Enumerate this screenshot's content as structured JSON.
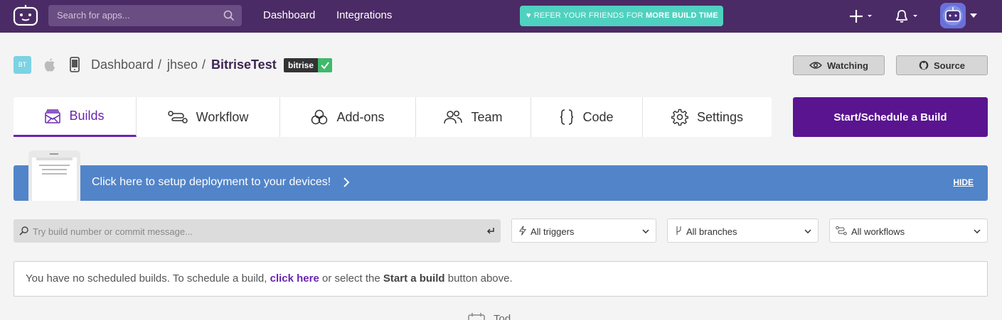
{
  "topbar": {
    "search_placeholder": "Search for apps...",
    "nav": [
      "Dashboard",
      "Integrations"
    ],
    "refer": {
      "prefix": "REFER YOUR FRIENDS FOR",
      "highlight": "MORE BUILD TIME"
    }
  },
  "header": {
    "app_initials": "BT",
    "breadcrumb": [
      "Dashboard",
      "jhseo",
      "BitriseTest"
    ],
    "separator": "/",
    "tag": "bitrise",
    "watching_label": "Watching",
    "source_label": "Source"
  },
  "tabs": [
    "Builds",
    "Workflow",
    "Add-ons",
    "Team",
    "Code",
    "Settings"
  ],
  "start_button": "Start/Schedule a Build",
  "banner": {
    "text": "Click here to setup deployment to your devices!",
    "hide": "HIDE"
  },
  "filters": {
    "search_placeholder": "Try build number or commit message...",
    "triggers": "All triggers",
    "branches": "All branches",
    "workflows": "All workflows"
  },
  "notice": {
    "part1": "You have no scheduled builds. To schedule a build,",
    "link": "click here",
    "part2": "or select the",
    "bold": "Start a build",
    "part3": "button above."
  },
  "bottom_label": "Tod",
  "colors": {
    "topbar": "#4b2b65",
    "accent": "#6a24b2",
    "start_button": "#5a1490",
    "banner": "#5284c9",
    "refer": "#4fd1c0",
    "success": "#3fb96a"
  }
}
